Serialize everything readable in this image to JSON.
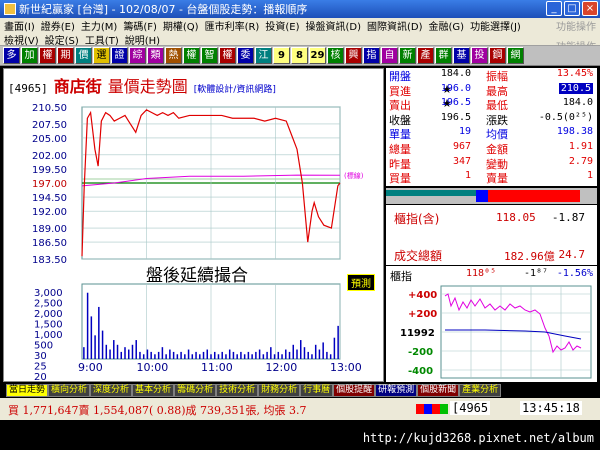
{
  "window": {
    "title": "新世紀贏家 [台灣] - 102/08/07 - 台盤個股走勢：播報順序",
    "min": "_",
    "max": "□",
    "close": "×"
  },
  "menu": {
    "row1": [
      "畫面(I)",
      "證券(E)",
      "主力(M)",
      "籌碼(F)",
      "期權(Q)",
      "匯市利率(R)",
      "投資(E)",
      "操盤資訊(D)",
      "國際資訊(D)",
      "金融(G)",
      "功能選擇(J)"
    ],
    "row2": [
      "檢視(V)",
      "設定(S)",
      "工具(T)",
      "說明(H)"
    ],
    "right1": "功能操作",
    "right2": "功能操作"
  },
  "toolbar": [
    "多",
    "加",
    "權",
    "期",
    "價",
    "選",
    "證",
    "綜",
    "類",
    "熱",
    "權",
    "智",
    "權",
    "委",
    "江",
    "9",
    "8",
    "29",
    "核",
    "興",
    "指",
    "自",
    "新",
    "產",
    "群",
    "基",
    "投",
    "鋼",
    "網"
  ],
  "header": {
    "code": "[4965]",
    "name": "商店街",
    "title": "量價走勢圖",
    "credit": "[軟體設計/資訊網路]"
  },
  "overlay": {
    "after_hours": "盤後延續撮合",
    "forecast": "預測",
    "ref_tag": "(標線)"
  },
  "quote": {
    "rows": [
      {
        "l1": "開盤",
        "v1": "184.0",
        "l2": "振幅",
        "v2": "13.45%"
      },
      {
        "l1": "買進",
        "mark": "★",
        "v1": "196.0",
        "l2": "最高",
        "v2": "210.5"
      },
      {
        "l1": "賣出",
        "mark": "★",
        "v1": "196.5",
        "l2": "最低",
        "v2": "184.0"
      },
      {
        "l1": "收盤",
        "v1": "196.5",
        "l2": "漲跌",
        "v2": "-0.5(0²⁵)"
      },
      {
        "l1": "單量",
        "v1": "19",
        "l2": "均價",
        "v2": "198.38"
      },
      {
        "l1": "總量",
        "v1": "967",
        "l2": "金額",
        "v2": "1.91"
      },
      {
        "l1": "昨量",
        "v1": "347",
        "l2": "變動",
        "v2": "2.79"
      },
      {
        "l1": "買量",
        "v1": "1",
        "l2": "賣量",
        "v2": "1"
      }
    ]
  },
  "index": {
    "label1": "櫃指(含)",
    "value1": "118.05",
    "change1": "-1.87",
    "label2": "成交總額",
    "value2": "182.96億",
    "change2": "24.7"
  },
  "mini": {
    "title": "櫃指",
    "value": "118⁰⁵",
    "change": "-1⁸⁷",
    "pct": "-1.56%",
    "ticks": [
      "+400",
      "+200",
      "11992",
      "-200",
      "-400"
    ]
  },
  "tabs": [
    "當日走勢",
    "橫向分析",
    "深度分析",
    "基本分析",
    "籌碼分析",
    "技術分析",
    "財務分析",
    "行事曆",
    "個股提醒",
    "研報預測",
    "個股新聞",
    "產業分析"
  ],
  "status": {
    "text": "買 1,771,647賣 1,554,087( 0.88)成 739,351張, 均張 3.7",
    "code": "[4965",
    "clock": "13:45:18"
  },
  "watermark": "http://kujd3268.pixnet.net/album",
  "colors": {
    "price": "#e00000",
    "avg": "#e000e0",
    "volume": "#0000c0",
    "ref": "#008000"
  },
  "chart_data": {
    "type": "line",
    "y_ticks": [
      "210.50",
      "207.50",
      "205.00",
      "202.00",
      "199.50",
      "197.00",
      "194.50",
      "192.00",
      "189.00",
      "186.50",
      "183.50"
    ],
    "ylim": [
      183.5,
      210.5
    ],
    "reference": 197.0,
    "x_ticks": [
      "9:00",
      "10:00",
      "11:00",
      "12:00",
      "13:00"
    ],
    "vol_ticks": [
      "3,000",
      "2,500",
      "2,000",
      "1,500",
      "1,000",
      "500",
      "30",
      "25",
      "20",
      "15",
      "張"
    ],
    "price": [
      [
        0,
        184.0
      ],
      [
        2,
        196.0
      ],
      [
        5,
        208.5
      ],
      [
        8,
        209.5
      ],
      [
        12,
        203.0
      ],
      [
        15,
        200.0
      ],
      [
        18,
        208.0
      ],
      [
        22,
        209.5
      ],
      [
        26,
        209.0
      ],
      [
        30,
        208.0
      ],
      [
        35,
        208.5
      ],
      [
        40,
        209.0
      ],
      [
        45,
        207.5
      ],
      [
        50,
        206.0
      ],
      [
        55,
        209.0
      ],
      [
        60,
        210.0
      ],
      [
        65,
        209.5
      ],
      [
        70,
        209.0
      ],
      [
        75,
        209.5
      ],
      [
        80,
        209.0
      ],
      [
        85,
        209.5
      ],
      [
        90,
        208.5
      ],
      [
        100,
        209.0
      ],
      [
        110,
        209.0
      ],
      [
        120,
        209.0
      ],
      [
        130,
        209.0
      ],
      [
        140,
        208.5
      ],
      [
        150,
        208.5
      ],
      [
        160,
        208.5
      ],
      [
        170,
        208.0
      ],
      [
        180,
        208.5
      ],
      [
        190,
        208.0
      ],
      [
        195,
        205.5
      ],
      [
        200,
        203.0
      ],
      [
        205,
        197.0
      ],
      [
        210,
        186.5
      ],
      [
        214,
        192.0
      ],
      [
        216,
        193.5
      ],
      [
        220,
        191.0
      ],
      [
        225,
        189.5
      ],
      [
        232,
        189.0
      ],
      [
        238,
        196.5
      ],
      [
        240,
        197.0
      ]
    ],
    "avg": [
      [
        0,
        196.5
      ],
      [
        30,
        197.0
      ],
      [
        60,
        197.8
      ],
      [
        100,
        198.2
      ],
      [
        150,
        198.2
      ],
      [
        200,
        198.4
      ],
      [
        240,
        198.38
      ]
    ],
    "volume": [
      5,
      28,
      18,
      10,
      22,
      12,
      6,
      4,
      8,
      6,
      3,
      5,
      4,
      6,
      8,
      3,
      2,
      4,
      3,
      2,
      3,
      5,
      2,
      4,
      3,
      2,
      3,
      2,
      4,
      2,
      3,
      2,
      3,
      4,
      2,
      3,
      2,
      3,
      2,
      4,
      3,
      2,
      3,
      2,
      3,
      2,
      3,
      4,
      2,
      3,
      5,
      2,
      3,
      2,
      4,
      3,
      6,
      4,
      8,
      5,
      3,
      2,
      6,
      4,
      7,
      3,
      2,
      9,
      14
    ],
    "minutes": 240
  }
}
